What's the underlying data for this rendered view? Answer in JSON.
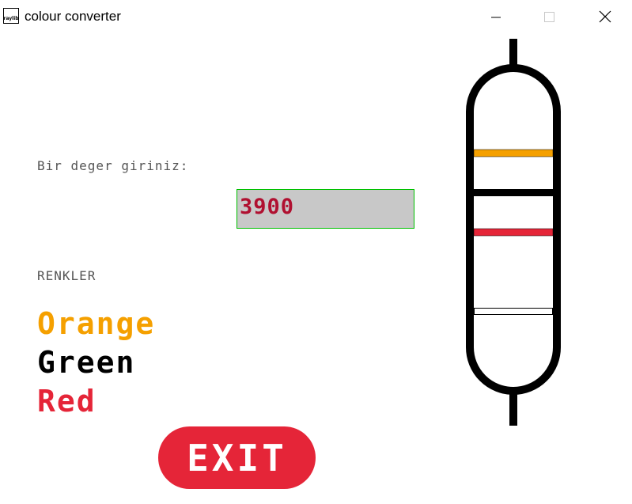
{
  "window": {
    "title": "colour converter",
    "icon_text": "raylib",
    "controls": [
      "minimize",
      "maximize",
      "close"
    ]
  },
  "form": {
    "prompt": "Bir deger giriniz:",
    "input_value": "3900"
  },
  "colors_section": {
    "heading": "RENKLER",
    "items": [
      {
        "name": "Orange",
        "color": "#f5a000"
      },
      {
        "name": "Green",
        "color": "#000000"
      },
      {
        "name": "Red",
        "color": "#e52538"
      }
    ]
  },
  "exit_button": {
    "label": "EXIT",
    "color": "#e52538"
  },
  "resistor": {
    "band_colors": [
      "#f5a000",
      "#e52538",
      "#ffffff"
    ],
    "body_color": "#000000"
  }
}
